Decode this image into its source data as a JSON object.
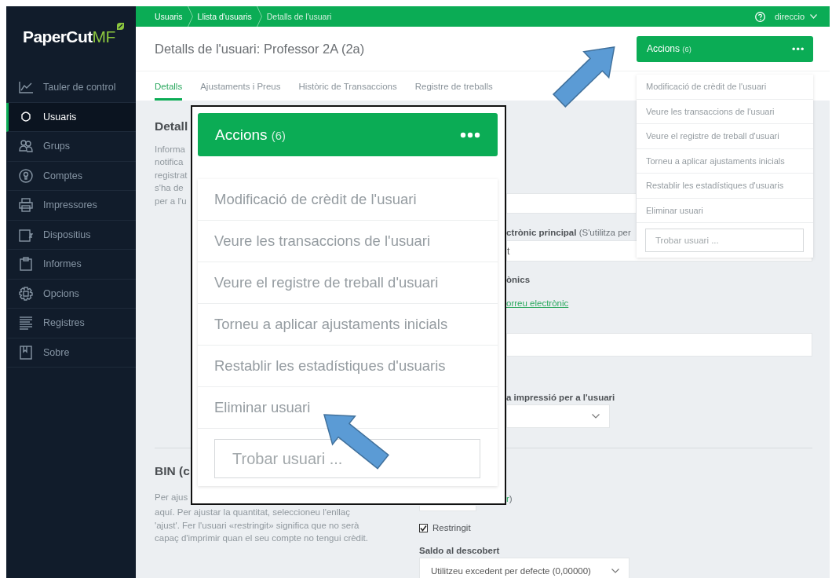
{
  "logo": {
    "name": "PaperCut",
    "edition": "MF"
  },
  "sidebar": {
    "items": [
      {
        "label": "Tauler de control",
        "selected": false
      },
      {
        "label": "Usuaris",
        "selected": true
      },
      {
        "label": "Grups",
        "selected": false
      },
      {
        "label": "Comptes",
        "selected": false
      },
      {
        "label": "Impressores",
        "selected": false
      },
      {
        "label": "Dispositius",
        "selected": false
      },
      {
        "label": "Informes",
        "selected": false
      },
      {
        "label": "Opcions",
        "selected": false
      },
      {
        "label": "Registres",
        "selected": false
      },
      {
        "label": "Sobre",
        "selected": false
      }
    ]
  },
  "breadcrumbs": [
    {
      "label": "Usuaris"
    },
    {
      "label": "Llista d'usuaris"
    },
    {
      "label": "Detalls de l'usuari"
    }
  ],
  "user_menu": {
    "label": "direccio"
  },
  "page_title": "Detalls de l'usuari: Professor 2A (2a)",
  "actions": {
    "label": "Accions",
    "count": "(6)",
    "items": [
      "Modificació de crèdit de l'usuari",
      "Veure les transaccions de l'usuari",
      "Veure el registre de treball d'usuari",
      "Torneu a aplicar ajustaments inicials",
      "Restablir les estadístiques d'usuaris",
      "Eliminar usuari"
    ],
    "search_placeholder": "Trobar usuari ..."
  },
  "tabs": [
    {
      "label": "Detalls",
      "selected": true
    },
    {
      "label": "Ajustaments i Preus",
      "selected": false
    },
    {
      "label": "Històric de Transaccions",
      "selected": false
    },
    {
      "label": "Registre de treballs",
      "selected": false
    }
  ],
  "details": {
    "title": "Detall",
    "description_lines": [
      "Informa",
      "notifica",
      "registrat",
      "s'ha de",
      "per a l'u"
    ],
    "email_label": "ctrònic principal",
    "email_hint": "(S'utilitza per",
    "email_value": "t",
    "other_emails_label": "ònics",
    "add_email_link": "orreu electrònic",
    "print_label": "a impressió per a l'usuari"
  },
  "bin": {
    "title": "BIN (c",
    "description_lines": [
      "Per ajus",
      "aquí. Per ajustar la quantitat, seleccioneu l'enllaç",
      "'ajust'. Fer l'usuari «restringit» significa que no serà",
      "capaç d'imprimir quan el seu compte no tengui crèdit."
    ],
    "adjust_link": "r",
    "adjust_close": ")",
    "restricted": {
      "label": "Restringit",
      "checked": true
    },
    "overdraft_label": "Saldo al descobert",
    "overdraft_value": "Utilitzeu excedent per defecte (0,00000)"
  },
  "callout": {
    "label": "Accions",
    "count": "(6)",
    "items": [
      "Modificació de crèdit de l'usuari",
      "Veure les transaccions de l'usuari",
      "Veure el registre de treball d'usuari",
      "Torneu a aplicar ajustaments inicials",
      "Restablir les estadístiques d'usuaris",
      "Eliminar usuari"
    ],
    "search_placeholder": "Trobar usuari ..."
  }
}
